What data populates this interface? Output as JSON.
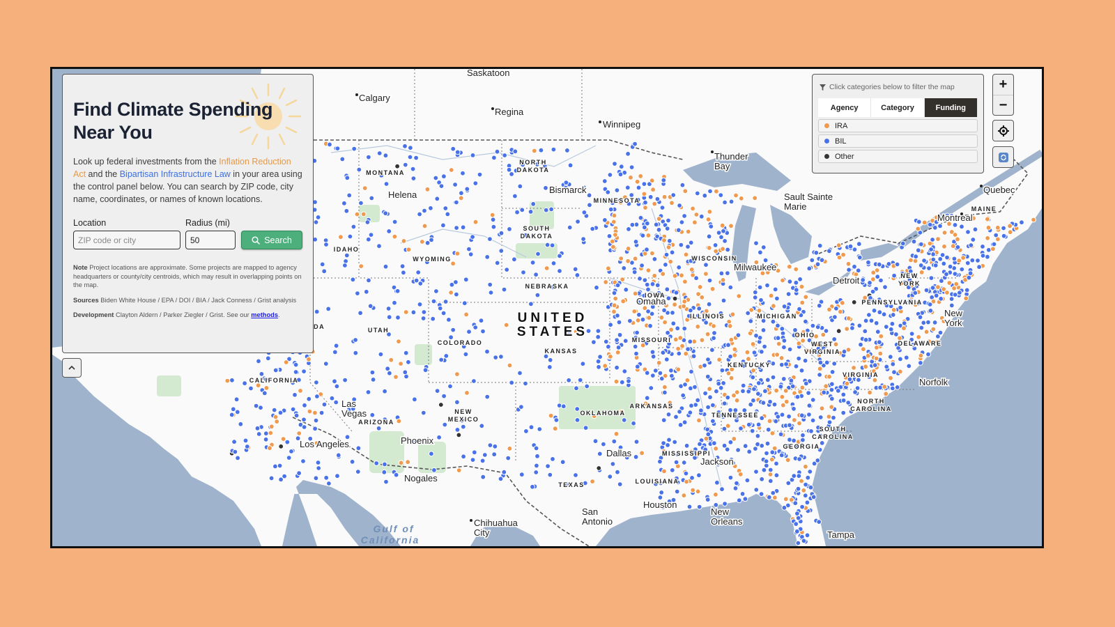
{
  "info_panel": {
    "title_line1": "Find Climate Spending",
    "title_line2": "Near You",
    "intro_pre": "Look up federal investments from the ",
    "intro_ira_link": "Inflation Reduction Act",
    "intro_mid": " and the ",
    "intro_bil_link": "Bipartisan Infrastructure Law",
    "intro_post": " in your area using the control panel below. You can search by ZIP code, city name, coordinates, or names of known locations.",
    "location_label": "Location",
    "location_placeholder": "ZIP code or city",
    "location_value": "",
    "radius_label": "Radius (mi)",
    "radius_value": "50",
    "search_label": "Search",
    "note_label": "Note",
    "note_text": " Project locations are approximate. Some projects are mapped to agency headquarters or county/city centroids, which may result in overlapping points on the map.",
    "sources_label": "Sources",
    "sources_text": " Biden White House / EPA / DOI / BIA / Jack Conness / Grist analysis",
    "development_label": "Development",
    "development_text": " Clayton Aldern / Parker Ziegler / Grist. See our ",
    "methods_link": "methods",
    "development_end": "."
  },
  "filter_panel": {
    "hint": "Click categories below to filter the map",
    "tabs": [
      {
        "label": "Agency",
        "active": false
      },
      {
        "label": "Category",
        "active": false
      },
      {
        "label": "Funding",
        "active": true
      }
    ],
    "legend": [
      {
        "label": "IRA",
        "color": "#ef9a4e"
      },
      {
        "label": "BIL",
        "color": "#4a72e8"
      },
      {
        "label": "Other",
        "color": "#333333"
      }
    ]
  },
  "map_controls": {
    "zoom_in": "+",
    "zoom_out": "−",
    "locate_icon": "crosshair-icon",
    "reset_icon": "refresh-icon"
  },
  "colors": {
    "ira": "#ef9a4e",
    "bil": "#4a72e8",
    "other": "#333333",
    "water": "#9fb3cc",
    "land": "#fafafa",
    "park": "#cfe6cc",
    "accent_green": "#4caf7c"
  },
  "map_labels": {
    "cities": [
      "Saskatoon",
      "Calgary",
      "Regina",
      "Winnipeg",
      "Thunder Bay",
      "Helena",
      "Bismarck",
      "Sault Sainte Marie",
      "Quebec",
      "Montreal",
      "Milwaukee",
      "Detroit",
      "Omaha",
      "New York",
      "Norfolk",
      "Las Vegas",
      "Los Angeles",
      "Phoenix",
      "Nogales",
      "Dallas",
      "Jackson",
      "Houston",
      "San Antonio",
      "New Orleans",
      "Chihuahua City",
      "Tampa"
    ],
    "states": [
      "MONTANA",
      "NORTH DAKOTA",
      "SOUTH DAKOTA",
      "MINNESOTA",
      "IDAHO",
      "WYOMING",
      "NEBRASKA",
      "IOWA",
      "WISCONSIN",
      "MICHIGAN",
      "NEVADA",
      "UTAH",
      "COLORADO",
      "KANSAS",
      "MISSOURI",
      "ILLINOIS",
      "OHIO",
      "KENTUCKY",
      "WEST VIRGINIA",
      "VIRGINIA",
      "PENNSYLVANIA",
      "NEW YORK",
      "MAINE",
      "CALIFORNIA",
      "ARIZONA",
      "NEW MEXICO",
      "TEXAS",
      "ARKANSAS",
      "TENNESSEE",
      "NORTH CAROLINA",
      "SOUTH CAROLINA",
      "GEORGIA",
      "MISSISSIPPI",
      "LOUISIANA",
      "DELAWARE",
      "OKLAHOMA"
    ],
    "country": "UNITED STATES",
    "water": "Gulf of California"
  }
}
